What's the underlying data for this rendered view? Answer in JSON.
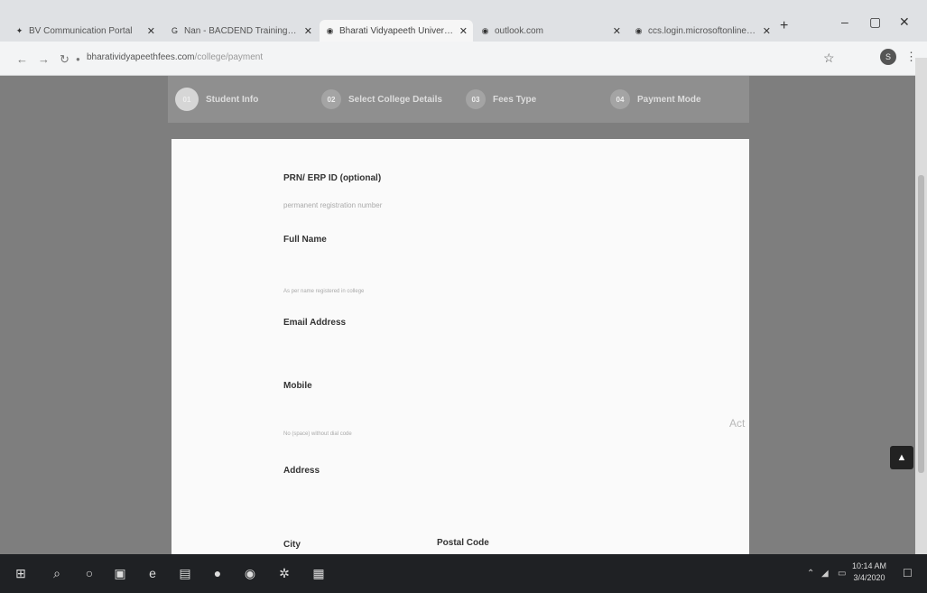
{
  "browser": {
    "tabs": [
      {
        "title": "BV Communication Portal",
        "favicon": "bv"
      },
      {
        "title": "Nan - BACDEND Training&Pl",
        "favicon": "google"
      },
      {
        "title": "Bharati Vidyapeeth University",
        "favicon": "globe"
      },
      {
        "title": "outlook.com",
        "favicon": "globe"
      },
      {
        "title": "ccs.login.microsoftonline.com",
        "favicon": "globe"
      }
    ],
    "url_host": "bharatividyapeethfees.com",
    "url_path": "/college/payment",
    "profile_initial": "S"
  },
  "stepper": {
    "steps": [
      {
        "num": "01",
        "label": "Student Info"
      },
      {
        "num": "02",
        "label": "Select College Details"
      },
      {
        "num": "03",
        "label": "Fees Type"
      },
      {
        "num": "04",
        "label": "Payment Mode"
      }
    ]
  },
  "form": {
    "prn_label": "PRN/ ERP ID (optional)",
    "prn_placeholder": "permanent registration number",
    "fullname_label": "Full Name",
    "fullname_hint": "As per name registered in college",
    "email_label": "Email Address",
    "mobile_label": "Mobile",
    "mobile_hint": "No (space) without dial code",
    "address_label": "Address",
    "city_label": "City",
    "postal_label": "Postal Code"
  },
  "watermark": "Act",
  "taskbar": {
    "time": "10:14 AM",
    "date": "3/4/2020"
  },
  "colors": {
    "page_background": "#7e7e7e",
    "card_background": "#fafafa",
    "taskbar": "#1f2124"
  }
}
